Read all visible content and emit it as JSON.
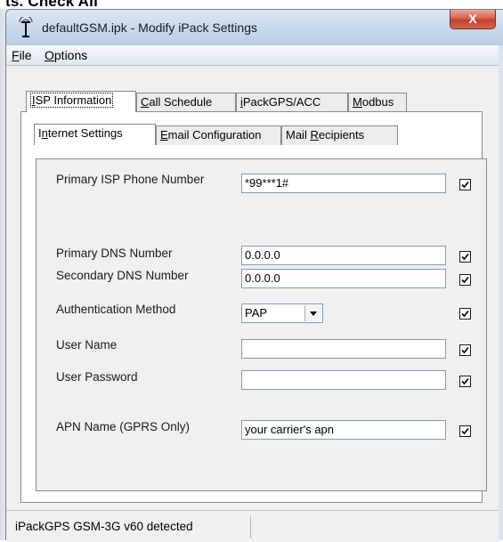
{
  "page_header": "ts. Check All",
  "window": {
    "title": "defaultGSM.ipk - Modify iPack Settings",
    "close_glyph": "X"
  },
  "menu": {
    "file": {
      "key": "F",
      "rest": "ile"
    },
    "options": {
      "key": "O",
      "rest": "ptions"
    }
  },
  "outer_tabs": [
    {
      "key": "I",
      "rest": "SP Information"
    },
    {
      "key": "C",
      "rest": "all Schedule"
    },
    {
      "pre": "",
      "key": "i",
      "rest": "PackGPS/ACC"
    },
    {
      "key": "M",
      "rest": "odbus"
    }
  ],
  "inner_tabs": [
    {
      "pre": "I",
      "key": "n",
      "rest": "ternet Settings"
    },
    {
      "key": "E",
      "rest": "mail Configuration"
    },
    {
      "pre": "Mail ",
      "key": "R",
      "rest": "ecipients"
    }
  ],
  "fields": {
    "primary_isp": {
      "label": "Primary ISP Phone Number",
      "value": "*99***1#",
      "checked": true
    },
    "primary_dns": {
      "label": "Primary DNS Number",
      "value": "0.0.0.0",
      "checked": true
    },
    "secondary_dns": {
      "label": "Secondary DNS Number",
      "value": "0.0.0.0",
      "checked": true
    },
    "auth_method": {
      "label": "Authentication Method",
      "value": "PAP",
      "checked": true
    },
    "user_name": {
      "label": "User Name",
      "value": "",
      "checked": true
    },
    "user_password": {
      "label": "User Password",
      "value": "",
      "checked": true
    },
    "apn_name": {
      "label": "APN Name (GPRS Only)",
      "value": "your carrier's apn",
      "checked": true
    }
  },
  "status": {
    "text": "iPackGPS GSM-3G v60 detected"
  }
}
